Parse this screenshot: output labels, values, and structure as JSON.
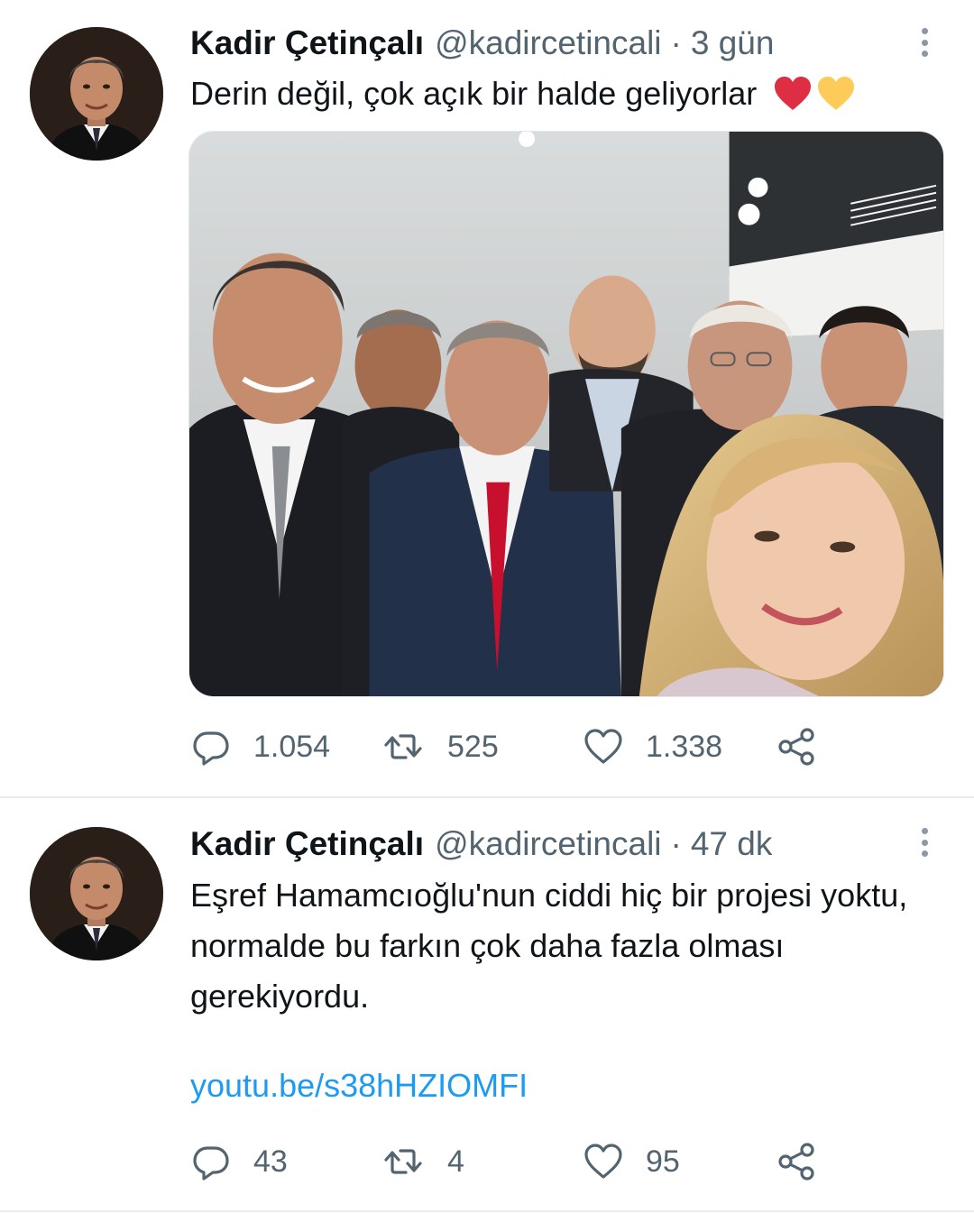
{
  "tweets": [
    {
      "author": {
        "name": "Kadir Çetinçalı",
        "handle": "@kadircetincali"
      },
      "separator": "·",
      "time": "3 gün",
      "text": "Derin değil, çok açık bir halde geliyorlar",
      "emoji": [
        "red-heart",
        "yellow-heart"
      ],
      "media": {
        "type": "photo",
        "description_icon": "group-selfie-photo"
      },
      "stats": {
        "replies": "1.054",
        "retweets": "525",
        "likes": "1.338"
      }
    },
    {
      "author": {
        "name": "Kadir Çetinçalı",
        "handle": "@kadircetincali"
      },
      "separator": "·",
      "time": "47 dk",
      "text": "Eşref Hamamcıoğlu'nun ciddi hiç bir projesi yoktu, normalde bu farkın çok daha fazla olması gerekiyordu.",
      "link": "youtu.be/s38hHZIOMFI",
      "stats": {
        "replies": "43",
        "retweets": "4",
        "likes": "95"
      }
    }
  ],
  "colors": {
    "text_primary": "#0f1419",
    "text_secondary": "#536471",
    "link": "#1d9bf0",
    "divider": "#e6ecf0"
  },
  "icons": [
    "more-icon",
    "reply-icon",
    "retweet-icon",
    "like-icon",
    "share-icon"
  ]
}
